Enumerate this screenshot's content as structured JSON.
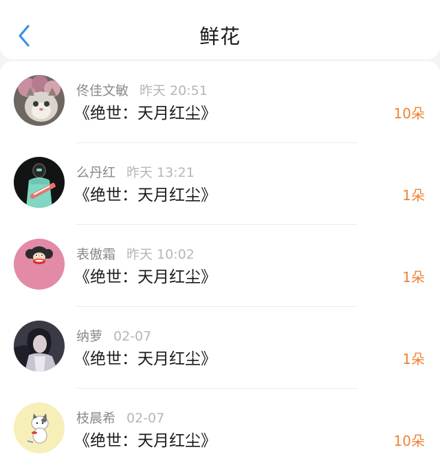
{
  "header": {
    "title": "鲜花",
    "back_icon": "chevron-left-icon",
    "accent": "#3a8fe6"
  },
  "rows": [
    {
      "name": "佟佳文敏",
      "time": "昨天 20:51",
      "gift": "《绝世：天月红尘》",
      "count": "10朵",
      "avatar": "cat-avatar"
    },
    {
      "name": "么丹红",
      "time": "昨天 13:21",
      "gift": "《绝世：天月红尘》",
      "count": "1朵",
      "avatar": "astronaut-avatar"
    },
    {
      "name": "表傲霜",
      "time": "昨天 10:02",
      "gift": "《绝世：天月红尘》",
      "count": "1朵",
      "avatar": "monkey-avatar"
    },
    {
      "name": "纳萝",
      "time": "02-07",
      "gift": "《绝世：天月红尘》",
      "count": "1朵",
      "avatar": "anime-avatar"
    },
    {
      "name": "枝晨希",
      "time": "02-07",
      "gift": "《绝世：天月红尘》",
      "count": "10朵",
      "avatar": "kitten-avatar"
    }
  ],
  "colors": {
    "count": "#f08232",
    "name": "#8a8a8a",
    "time": "#b6b6b6"
  }
}
